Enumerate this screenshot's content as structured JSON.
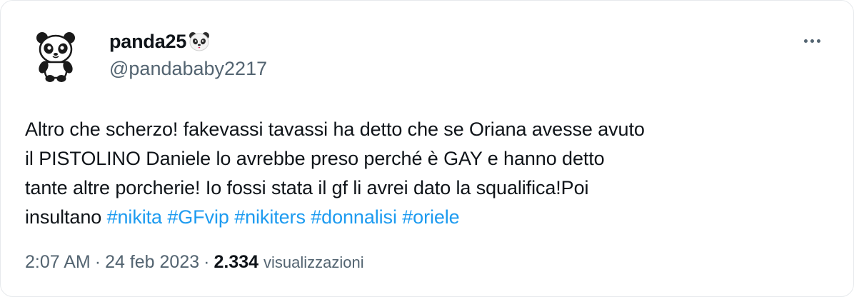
{
  "user": {
    "display_name": "panda25",
    "name_emoji": "panda-face-emoji",
    "handle": "@pandababy2217",
    "avatar_icon": "panda-avatar-icon"
  },
  "tweet": {
    "line1": "Altro che scherzo! fakevassi tavassi ha detto che se Oriana avesse avuto",
    "line2": "il PISTOLINO Daniele lo  avrebbe preso perché è GAY e hanno detto",
    "line3": "tante altre porcherie! Io fossi stata il gf li avrei dato la squalifica!Poi",
    "line4_prefix": "insultano",
    "hashtags": [
      "#nikita",
      "#GFvip",
      "#nikiters",
      "#donnalisi",
      "#oriele"
    ]
  },
  "meta": {
    "time": "2:07 AM",
    "separator": "·",
    "date": "24 feb 2023",
    "views_count": "2.334",
    "views_label": "visualizzazioni"
  },
  "colors": {
    "hashtag": "#1d9bf0",
    "secondary_text": "#536471",
    "primary_text": "#0f1419"
  },
  "more_icon": "more-options-icon"
}
